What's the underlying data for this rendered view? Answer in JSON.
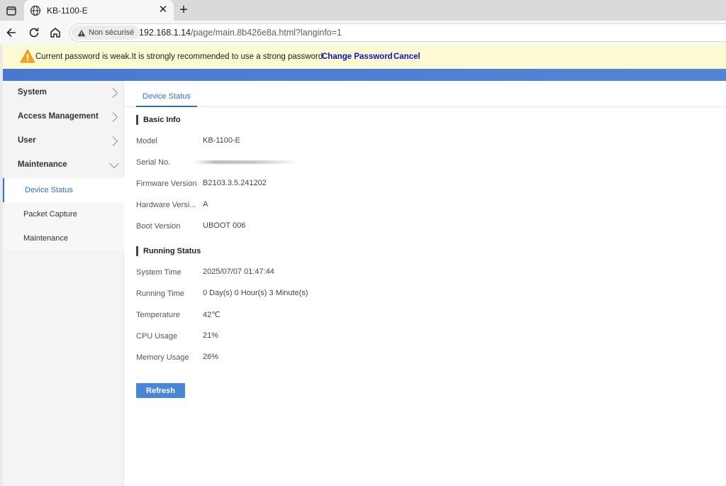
{
  "browser": {
    "tab_title": "KB-1100-E",
    "security_label": "Non sécurisé",
    "url_host": "192.168.1.14",
    "url_path": "/page/main.8b426e8a.html?langinfo=1"
  },
  "warning": {
    "message": "Current password is weak.It is strongly recommended to use a strong password.",
    "change_password": "Change Password",
    "cancel": "Cancel"
  },
  "sidebar": {
    "items": [
      {
        "label": "System",
        "expanded": false
      },
      {
        "label": "Access Management",
        "expanded": false
      },
      {
        "label": "User",
        "expanded": false
      },
      {
        "label": "Maintenance",
        "expanded": true
      }
    ],
    "subitems": [
      {
        "label": "Device Status",
        "active": true
      },
      {
        "label": "Packet Capture",
        "active": false
      },
      {
        "label": "Maintenance",
        "active": false
      }
    ]
  },
  "main": {
    "tab": "Device Status",
    "basic_info": {
      "title": "Basic Info",
      "rows": [
        {
          "label": "Model",
          "value": "KB-1100-E"
        },
        {
          "label": "Serial No.",
          "value": ""
        },
        {
          "label": "Firmware Version",
          "value": "B2103.3.5.241202"
        },
        {
          "label": "Hardware Versi...",
          "value": "A"
        },
        {
          "label": "Boot Version",
          "value": "UBOOT 006"
        }
      ]
    },
    "running_status": {
      "title": "Running Status",
      "rows": [
        {
          "label": "System Time",
          "value": "2025/07/07 01:47:44"
        },
        {
          "label": "Running Time",
          "value": "0 Day(s) 0 Hour(s) 3 Minute(s)"
        },
        {
          "label": "Temperature",
          "value": "42℃"
        },
        {
          "label": "CPU Usage",
          "value": "21%"
        },
        {
          "label": "Memory Usage",
          "value": "26%"
        }
      ]
    },
    "refresh_label": "Refresh"
  },
  "colors": {
    "accent": "#2f6fd6",
    "banner_bg": "#fbfad2",
    "header_bar": "#4979cf",
    "link": "#0a10c8"
  },
  "icons": [
    "window-icon",
    "globe-icon",
    "close-icon",
    "plus-icon",
    "back-icon",
    "reload-icon",
    "home-icon",
    "warning-icon",
    "chevron-right-icon",
    "chevron-down-icon"
  ]
}
